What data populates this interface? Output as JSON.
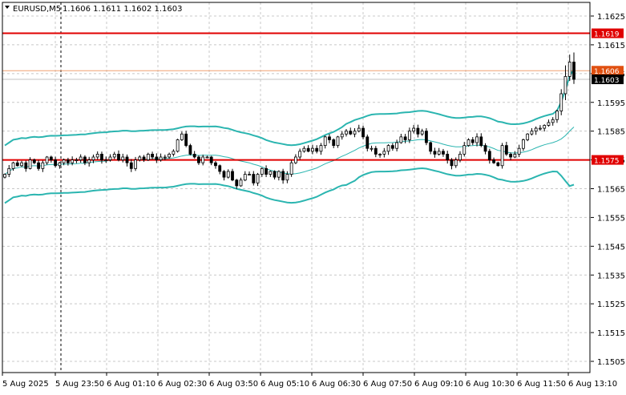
{
  "header": {
    "symbol": "EURUSD,M5",
    "ohlc": "1.1606 1.1611 1.1602 1.1603"
  },
  "colors": {
    "background": "#ffffff",
    "grid": "#c8c8c8",
    "candle": "#000000",
    "bollinger": "#2bb5b0",
    "support_resistance": "#e00000",
    "bid_line": "#f0a070",
    "ask_line": "#c0c0c0",
    "bid_label_bg": "#e05010",
    "price_label_bg": "#000000"
  },
  "chart_data": {
    "type": "candlestick",
    "symbol": "EURUSD",
    "timeframe": "M5",
    "y_ticks": [
      "1.1625",
      "1.1615",
      "1.1605",
      "1.1595",
      "1.1585",
      "1.1575",
      "1.1565",
      "1.1555",
      "1.1545",
      "1.1535",
      "1.1525",
      "1.1515",
      "1.1505"
    ],
    "x_ticks": [
      "5 Aug 2025",
      "5 Aug 23:50",
      "6 Aug 01:10",
      "6 Aug 02:30",
      "6 Aug 03:50",
      "6 Aug 05:10",
      "6 Aug 06:30",
      "6 Aug 07:50",
      "6 Aug 09:10",
      "6 Aug 10:30",
      "6 Aug 11:50",
      "6 Aug 13:10"
    ],
    "ylim": [
      1.15,
      1.163
    ],
    "horizontal_levels": [
      {
        "price": 1.1619,
        "label": "1.1619",
        "kind": "resistance"
      },
      {
        "price": 1.1575,
        "label": "1.1575",
        "kind": "support"
      }
    ],
    "price_labels": [
      {
        "price": 1.1606,
        "label": "1.1606",
        "kind": "bid"
      },
      {
        "price": 1.1603,
        "label": "1.1603",
        "kind": "last"
      }
    ],
    "vertical_marker": "5 Aug 23:50",
    "grid": true,
    "closes": [
      1.157,
      1.1572,
      1.1574,
      1.1573,
      1.1574,
      1.1572,
      1.1575,
      1.1574,
      1.1572,
      1.1574,
      1.1576,
      1.1575,
      1.1573,
      1.1574,
      1.1575,
      1.1574,
      1.1575,
      1.1575,
      1.1576,
      1.1574,
      1.1575,
      1.1576,
      1.1577,
      1.1575,
      1.1575,
      1.1576,
      1.1577,
      1.1575,
      1.1576,
      1.1574,
      1.1572,
      1.1575,
      1.1576,
      1.1575,
      1.1577,
      1.1576,
      1.1575,
      1.1576,
      1.1576,
      1.1577,
      1.1578,
      1.1582,
      1.1584,
      1.158,
      1.1577,
      1.1576,
      1.1574,
      1.1576,
      1.1576,
      1.1574,
      1.1573,
      1.1571,
      1.1569,
      1.1571,
      1.1568,
      1.1566,
      1.1568,
      1.157,
      1.157,
      1.1567,
      1.157,
      1.1572,
      1.157,
      1.1571,
      1.1569,
      1.1571,
      1.1568,
      1.157,
      1.1574,
      1.1576,
      1.1578,
      1.1579,
      1.1578,
      1.1579,
      1.1578,
      1.158,
      1.1583,
      1.1582,
      1.158,
      1.1583,
      1.1584,
      1.1585,
      1.1584,
      1.1585,
      1.1586,
      1.1583,
      1.1579,
      1.1579,
      1.1577,
      1.1577,
      1.1578,
      1.158,
      1.1579,
      1.1581,
      1.1583,
      1.1582,
      1.1585,
      1.1586,
      1.1584,
      1.1585,
      1.1581,
      1.1578,
      1.1577,
      1.1578,
      1.1577,
      1.1575,
      1.1573,
      1.1575,
      1.1577,
      1.158,
      1.1582,
      1.1581,
      1.1583,
      1.158,
      1.1578,
      1.1575,
      1.1574,
      1.1573,
      1.158,
      1.1577,
      1.1576,
      1.1577,
      1.1579,
      1.1582,
      1.1584,
      1.1585,
      1.1586,
      1.1586,
      1.1587,
      1.1588,
      1.1589,
      1.1592,
      1.1598,
      1.1604,
      1.1609,
      1.1603
    ]
  }
}
